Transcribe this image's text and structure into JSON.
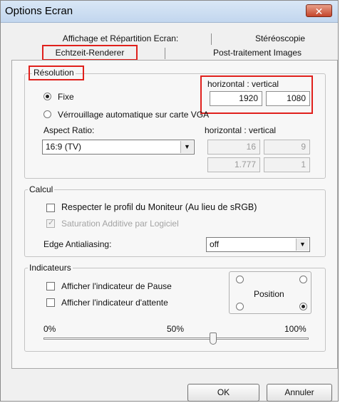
{
  "window": {
    "title": "Options Ecran",
    "close_label": "✕"
  },
  "tabs": {
    "row1": [
      "Affichage et Répartition Ecran:",
      "Stéréoscopie"
    ],
    "row2": [
      "Echtzeit-Renderer",
      "Post-traitement Images"
    ],
    "selected": "Echtzeit-Renderer"
  },
  "resolution": {
    "legend": "Résolution",
    "header": "horizontal : vertical",
    "fixe_label": "Fixe",
    "fixe_checked": true,
    "width": "1920",
    "height": "1080",
    "vga_label": "Vérrouillage automatique sur carte VGA",
    "vga_checked": false,
    "aspect_label": "Aspect Ratio:",
    "aspect_header": "horizontal : vertical",
    "aspect_value": "16:9 (TV)",
    "aspect_h": "16",
    "aspect_v": "9",
    "ratio_h": "1.777",
    "ratio_v": "1"
  },
  "calcul": {
    "legend": "Calcul",
    "profile_label": "Respecter le profil du Moniteur (Au lieu de sRGB)",
    "profile_checked": false,
    "saturation_label": "Saturation Additive par Logiciel",
    "saturation_checked": true,
    "saturation_enabled": false,
    "edge_label": "Edge Antialiasing:",
    "edge_value": "off"
  },
  "indicateurs": {
    "legend": "Indicateurs",
    "pause_label": "Afficher l'indicateur de Pause",
    "pause_checked": false,
    "wait_label": "Afficher l'indicateur d'attente",
    "wait_checked": false,
    "position_label": "Position",
    "position_selected": "bottom-right",
    "slider_min": "0%",
    "slider_mid": "50%",
    "slider_max": "100%",
    "slider_value": 0.75
  },
  "buttons": {
    "ok": "OK",
    "cancel": "Annuler"
  },
  "colors": {
    "highlight": "#e0201c",
    "titlebar": "#c8daf0"
  }
}
